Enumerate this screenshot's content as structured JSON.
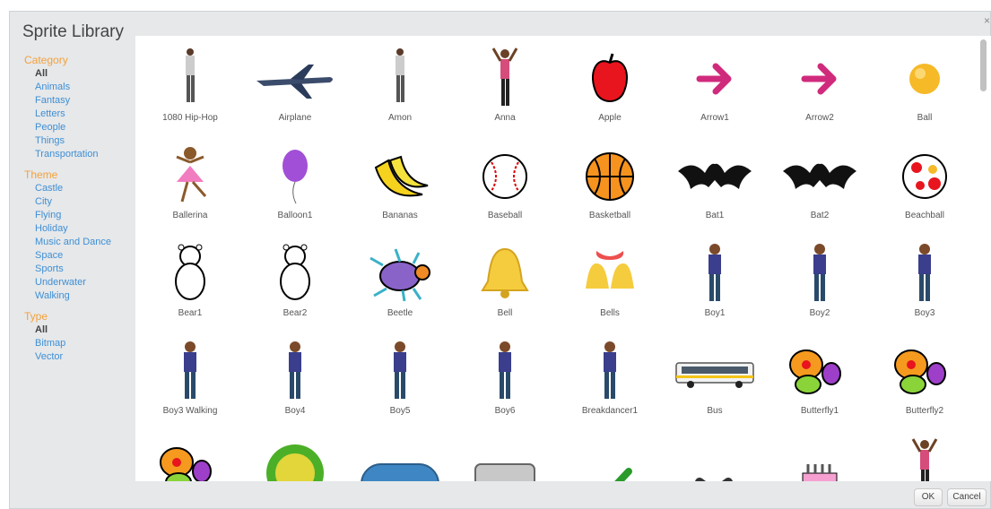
{
  "dialog": {
    "title": "Sprite Library",
    "close_label": "×",
    "ok_label": "OK",
    "cancel_label": "Cancel"
  },
  "filters": {
    "category": {
      "heading": "Category",
      "items": [
        "All",
        "Animals",
        "Fantasy",
        "Letters",
        "People",
        "Things",
        "Transportation"
      ],
      "selected": "All"
    },
    "theme": {
      "heading": "Theme",
      "items": [
        "Castle",
        "City",
        "Flying",
        "Holiday",
        "Music and Dance",
        "Space",
        "Sports",
        "Underwater",
        "Walking"
      ]
    },
    "type": {
      "heading": "Type",
      "items": [
        "All",
        "Bitmap",
        "Vector"
      ],
      "selected": "All"
    }
  },
  "sprites": [
    {
      "name": "1080 Hip-Hop",
      "icon": "dancer-person-icon"
    },
    {
      "name": "Airplane",
      "icon": "airplane-icon"
    },
    {
      "name": "Amon",
      "icon": "dancer-person-icon"
    },
    {
      "name": "Anna",
      "icon": "person-icon"
    },
    {
      "name": "Apple",
      "icon": "apple-icon"
    },
    {
      "name": "Arrow1",
      "icon": "arrow-icon"
    },
    {
      "name": "Arrow2",
      "icon": "arrow-icon"
    },
    {
      "name": "Ball",
      "icon": "ball-icon"
    },
    {
      "name": "Ballerina",
      "icon": "ballerina-icon"
    },
    {
      "name": "Balloon1",
      "icon": "balloon-icon"
    },
    {
      "name": "Bananas",
      "icon": "bananas-icon"
    },
    {
      "name": "Baseball",
      "icon": "baseball-icon"
    },
    {
      "name": "Basketball",
      "icon": "basketball-icon"
    },
    {
      "name": "Bat1",
      "icon": "bat-icon"
    },
    {
      "name": "Bat2",
      "icon": "bat-icon"
    },
    {
      "name": "Beachball",
      "icon": "beachball-icon"
    },
    {
      "name": "Bear1",
      "icon": "bear-icon"
    },
    {
      "name": "Bear2",
      "icon": "bear-icon"
    },
    {
      "name": "Beetle",
      "icon": "beetle-icon"
    },
    {
      "name": "Bell",
      "icon": "bell-icon"
    },
    {
      "name": "Bells",
      "icon": "bells-icon"
    },
    {
      "name": "Boy1",
      "icon": "boy-icon"
    },
    {
      "name": "Boy2",
      "icon": "boy-icon"
    },
    {
      "name": "Boy3",
      "icon": "boy-icon"
    },
    {
      "name": "Boy3 Walking",
      "icon": "boy-icon"
    },
    {
      "name": "Boy4",
      "icon": "boy-icon"
    },
    {
      "name": "Boy5",
      "icon": "boy-icon"
    },
    {
      "name": "Boy6",
      "icon": "boy-icon"
    },
    {
      "name": "Breakdancer1",
      "icon": "boy-icon"
    },
    {
      "name": "Bus",
      "icon": "bus-icon"
    },
    {
      "name": "Butterfly1",
      "icon": "butterfly-icon"
    },
    {
      "name": "Butterfly2",
      "icon": "butterfly-icon"
    },
    {
      "name": "",
      "icon": "butterfly-icon"
    },
    {
      "name": "",
      "icon": "green-button-icon"
    },
    {
      "name": "",
      "icon": "blue-button-icon"
    },
    {
      "name": "",
      "icon": "gray-button-icon"
    },
    {
      "name": "",
      "icon": "checkmark-icon"
    },
    {
      "name": "",
      "icon": "x-mark-icon"
    },
    {
      "name": "",
      "icon": "cake-icon"
    },
    {
      "name": "",
      "icon": "person-icon"
    }
  ]
}
